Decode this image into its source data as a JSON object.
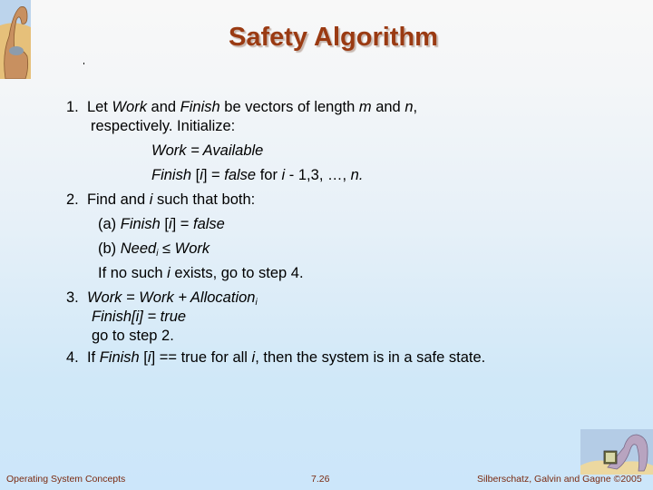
{
  "slide": {
    "title": "Safety Algorithm",
    "steps": {
      "s1": {
        "num": "1.",
        "l1_a": "Let ",
        "l1_b": "Work",
        "l1_c": " and ",
        "l1_d": "Finish",
        "l1_e": " be vectors of length ",
        "l1_f": "m",
        "l1_g": " and ",
        "l1_h": "n",
        "l1_i": ",",
        "l2": "respectively.  Initialize:",
        "l3": "Work = Available",
        "l4_a": "Finish",
        "l4_b": " [",
        "l4_c": "i",
        "l4_d": "] = ",
        "l4_e": "false",
        "l4_f": " for ",
        "l4_g": "i",
        "l4_h": " - 1,3, …, ",
        "l4_i": "n."
      },
      "s2": {
        "num": "2.",
        "l1_a": "Find and ",
        "l1_b": "i",
        "l1_c": " such that both:",
        "a_a": "(a) ",
        "a_b": "Finish",
        "a_c": " [",
        "a_d": "i",
        "a_e": "] = ",
        "a_f": "false",
        "b_a": "(b) ",
        "b_b": "Need",
        "b_sub": "i",
        "b_c": " ≤ ",
        "b_d": "Work",
        "l4_a": "If no such ",
        "l4_b": "i",
        "l4_c": " exists, go to step 4."
      },
      "s3": {
        "num": "3.",
        "l1": "Work = Work + Allocation",
        "l1_sub": "i",
        "l2_a": "Finish",
        "l2_b": "[",
        "l2_c": "i",
        "l2_d": "] = true",
        "l3": "go to step 2."
      },
      "s4": {
        "num": "4.",
        "a": "If ",
        "b": "Finish",
        "c": " [",
        "d": "i",
        "e": "] == true for all ",
        "f": "i",
        "g": ", then the system is in a safe state."
      }
    }
  },
  "footer": {
    "left": "Operating System Concepts",
    "center": "7.26",
    "right": "Silberschatz, Galvin and Gagne ©2005"
  },
  "icons": {
    "top_left": "dinosaur-illustration",
    "bottom_right": "dinosaur-laptop-illustration"
  }
}
